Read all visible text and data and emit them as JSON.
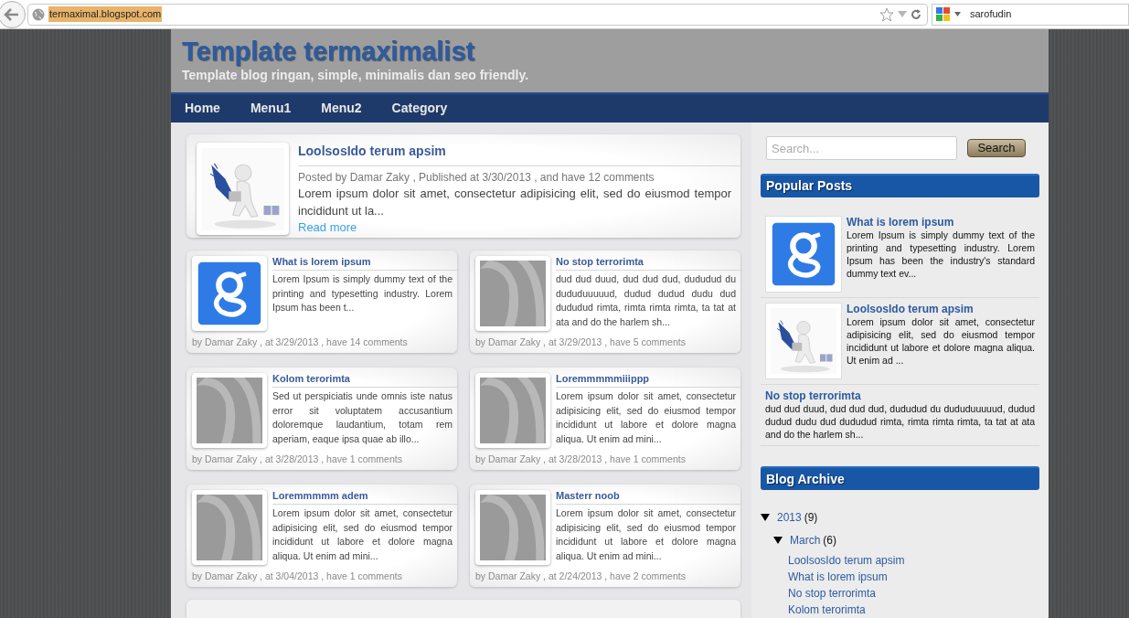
{
  "browser": {
    "url": "termaximal.blogspot.com",
    "search_engine_user": "sarofudin"
  },
  "blog": {
    "title": "Template termaximalist",
    "subtitle": "Template blog ringan, simple, minimalis dan seo friendly."
  },
  "nav": [
    {
      "label": "Home"
    },
    {
      "label": "Menu1"
    },
    {
      "label": "Menu2"
    },
    {
      "label": "Category"
    }
  ],
  "featured": {
    "title": "LoolsosIdo terum apsim",
    "meta": "Posted by Damar Zaky , Published at 3/30/2013 , and have 12 comments",
    "excerpt": "Lorem ipsum dolor sit amet, consectetur adipisicing elit, sed do eiusmod tempor incididunt ut la...",
    "read_more": "Read more",
    "kind": "figure"
  },
  "posts": [
    {
      "title": "What is lorem ipsum",
      "excerpt": "Lorem Ipsum is simply dummy text of the printing and typesetting industry. Lorem Ipsum has been t...",
      "meta": "by Damar Zaky , at 3/29/2013 , have 14 comments",
      "kind": "tile"
    },
    {
      "title": "No stop terrorimta",
      "excerpt": "dud dud duud, dud dud dud, dududud du dududuuuuud, dudud dudud dudu dud dududud rimta, rimta rimta rimta, ta tat at ata and do the harlem sh...",
      "meta": "by Damar Zaky , at 3/29/2013 , have 5 comments",
      "kind": "placeholder"
    },
    {
      "title": "Kolom terorimta",
      "excerpt": "Sed ut perspiciatis unde omnis iste natus error sit voluptatem accusantium doloremque laudantium, totam rem aperiam, eaque ipsa quae ab illo...",
      "meta": "by Damar Zaky , at 3/28/2013 , have 1 comments",
      "kind": "placeholder"
    },
    {
      "title": "Loremmmmmiiippp",
      "excerpt": "Lorem ipsum dolor sit amet, consectetur adipisicing elit, sed do eiusmod tempor incididunt ut labore et dolore magna aliqua. Ut enim ad mini...",
      "meta": "by Damar Zaky , at 3/28/2013 , have 1 comments",
      "kind": "placeholder"
    },
    {
      "title": "Loremmmmm adem",
      "excerpt": "Lorem ipsum dolor sit amet, consectetur adipisicing elit, sed do eiusmod tempor incididunt ut labore et dolore magna aliqua. Ut enim ad mini...",
      "meta": "by Damar Zaky , at 3/04/2013 , have 1 comments",
      "kind": "placeholder"
    },
    {
      "title": "Masterr noob",
      "excerpt": "Lorem ipsum dolor sit amet, consectetur adipisicing elit, sed do eiusmod tempor incididunt ut labore et dolore magna aliqua. Ut enim ad mini...",
      "meta": "by Damar Zaky , at 2/24/2013 , have 2 comments",
      "kind": "placeholder"
    }
  ],
  "sidebar": {
    "search": {
      "placeholder": "Search...",
      "button": "Search"
    },
    "popular_posts": {
      "title": "Popular Posts",
      "items": [
        {
          "title": "What is lorem ipsum",
          "excerpt": "Lorem Ipsum is simply dummy text of the printing and typesetting industry. Lorem Ipsum has been the industry's standard dummy text ev...",
          "kind": "tile"
        },
        {
          "title": "LoolsosIdo terum apsim",
          "excerpt": "Lorem ipsum dolor sit amet, consectetur adipisicing elit, sed do eiusmod tempor incididunt ut labore et dolore magna aliqua. Ut enim ad ...",
          "kind": "figure"
        },
        {
          "title": "No stop terrorimta",
          "excerpt": "dud dud duud, dud dud dud, dududud du dududuuuuud, dudud dudud dudu dud dududud rimta, rimta rimta rimta, ta tat at ata and do the harlem sh...",
          "kind": "text"
        }
      ]
    },
    "blog_archive": {
      "title": "Blog Archive",
      "items": [
        {
          "label": "2013",
          "count": "(9)",
          "expanded": true,
          "children": [
            {
              "label": "March",
              "count": "(6)",
              "expanded": true,
              "children": [
                {
                  "label": "LoolsosIdo terum apsim"
                },
                {
                  "label": "What is lorem ipsum"
                },
                {
                  "label": "No stop terrorimta"
                },
                {
                  "label": "Kolom terorimta"
                }
              ]
            }
          ]
        }
      ]
    }
  }
}
